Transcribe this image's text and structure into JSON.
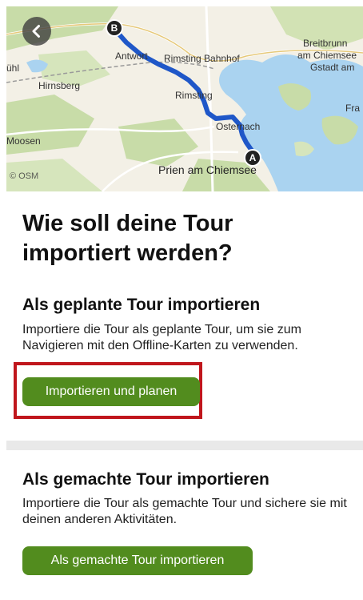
{
  "map": {
    "labels": {
      "antwort": "Antwort",
      "rimsting_bahnhof": "Rimsting Bahnhof",
      "breitbrunn": "Breitbrunn",
      "am_chiemsee": "am Chiemsee",
      "gstadt": "Gstadt am",
      "hirnsberg": "Hirnsberg",
      "rimsting": "Rimsting",
      "osternach": "Osternach",
      "moosen": "Moosen",
      "prien": "Prien am Chiemsee",
      "fra": "Fra",
      "uhl": "ühl"
    },
    "credit": "© OSM",
    "start_marker": "A",
    "end_marker": "B",
    "colors": {
      "route": "#1f57c8",
      "water": "#aad3f0",
      "forest": "#c8dca8",
      "land": "#f3f0e6"
    }
  },
  "headline": "Wie soll deine Tour importiert werden?",
  "planned": {
    "title": "Als geplante Tour importieren",
    "description": "Importiere die Tour als geplante Tour, um sie zum Navigieren mit den Offline-Karten zu verwenden.",
    "button_label": "Importieren und planen"
  },
  "completed": {
    "title": "Als gemachte Tour importieren",
    "description": "Importiere die Tour als gemachte Tour und sichere sie mit deinen anderen Aktivitäten.",
    "button_label": "Als gemachte Tour importieren"
  },
  "colors": {
    "button_green": "#528c1e",
    "highlight_red": "#c0161c",
    "divider_gray": "#e9e9e9"
  },
  "icons": {
    "back": "chevron-left-icon"
  }
}
